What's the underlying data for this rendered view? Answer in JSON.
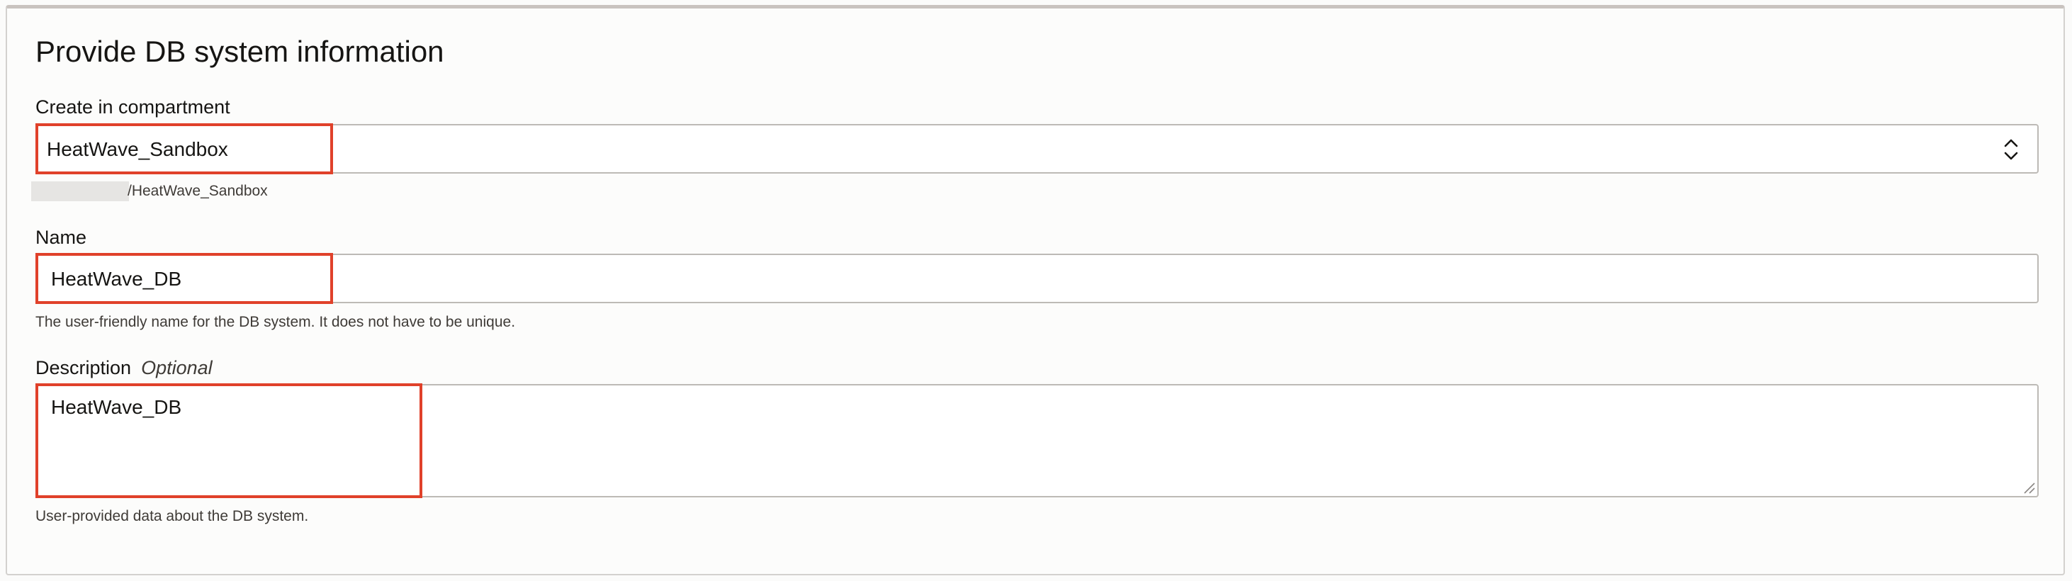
{
  "section": {
    "title": "Provide DB system information"
  },
  "compartment": {
    "label": "Create in compartment",
    "value": "HeatWave_Sandbox",
    "path_suffix": "/HeatWave_Sandbox",
    "icon": "chevron-up-down-icon"
  },
  "name": {
    "label": "Name",
    "value": "HeatWave_DB",
    "helper": "The user-friendly name for the DB system. It does not have to be unique."
  },
  "description": {
    "label": "Description",
    "optional_label": "Optional",
    "value": "HeatWave_DB",
    "helper": "User-provided data about the DB system."
  },
  "colors": {
    "highlight": "#e0412a",
    "border": "#bdbab6",
    "text": "#161513"
  }
}
